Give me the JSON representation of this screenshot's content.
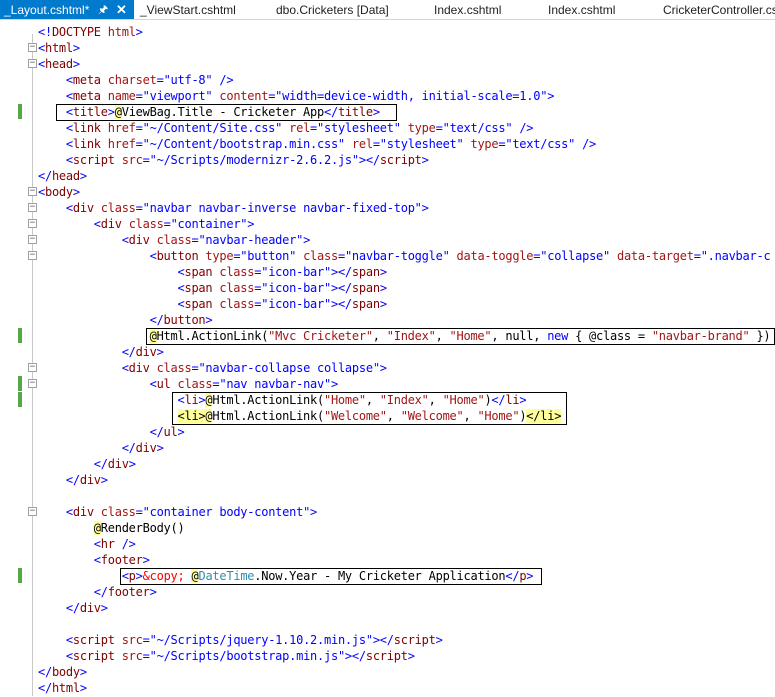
{
  "tabs": [
    {
      "label": "_Layout.cshtml*",
      "active": true
    },
    {
      "label": "_ViewStart.cshtml"
    },
    {
      "label": "dbo.Cricketers [Data]"
    },
    {
      "label": "Index.cshtml"
    },
    {
      "label": "Index.cshtml"
    },
    {
      "label": "CricketerController.cs"
    }
  ],
  "tab_icons": {
    "pin": "pin-icon",
    "close": "close-icon"
  },
  "colors": {
    "accent": "#007acc",
    "tag": "#800000",
    "attribute": "#ff0000",
    "value": "#0000ff",
    "razor_highlight": "#ffff99",
    "change_marker": "#57a64a"
  },
  "code": {
    "lines": [
      [
        [
          "<!",
          "pu"
        ],
        [
          "DOCTYPE",
          "kw"
        ],
        [
          " ",
          ""
        ],
        [
          "html",
          "at"
        ],
        [
          ">",
          "pu"
        ]
      ],
      [
        [
          "<",
          "pu"
        ],
        [
          "html",
          "kw"
        ],
        [
          ">",
          "pu"
        ]
      ],
      [
        [
          "<",
          "pu"
        ],
        [
          "head",
          "kw"
        ],
        [
          ">",
          "pu"
        ]
      ],
      [
        [
          "    <",
          "pu"
        ],
        [
          "meta",
          "kw"
        ],
        [
          " charset",
          "at"
        ],
        [
          "=",
          "pu"
        ],
        [
          "\"utf-8\"",
          "val"
        ],
        [
          " />",
          "pu"
        ]
      ],
      [
        [
          "    <",
          "pu"
        ],
        [
          "meta",
          "kw"
        ],
        [
          " name",
          "at"
        ],
        [
          "=",
          "pu"
        ],
        [
          "\"viewport\"",
          "val"
        ],
        [
          " content",
          "at"
        ],
        [
          "=",
          "pu"
        ],
        [
          "\"width=device-width, initial-scale=1.0\"",
          "val"
        ],
        [
          ">",
          "pu"
        ]
      ],
      [
        [
          "    <",
          "pu"
        ],
        [
          "title",
          "kw"
        ],
        [
          ">",
          "pu"
        ],
        [
          "@",
          "rz"
        ],
        [
          "ViewBag.Title - Cricketer App",
          "cs"
        ],
        [
          "</",
          "pu"
        ],
        [
          "title",
          "kw"
        ],
        [
          ">",
          "pu"
        ]
      ],
      [
        [
          "    <",
          "pu"
        ],
        [
          "link",
          "kw"
        ],
        [
          " href",
          "at"
        ],
        [
          "=",
          "pu"
        ],
        [
          "\"~/Content/Site.css\"",
          "val"
        ],
        [
          " rel",
          "at"
        ],
        [
          "=",
          "pu"
        ],
        [
          "\"stylesheet\"",
          "val"
        ],
        [
          " type",
          "at"
        ],
        [
          "=",
          "pu"
        ],
        [
          "\"text/css\"",
          "val"
        ],
        [
          " />",
          "pu"
        ]
      ],
      [
        [
          "    <",
          "pu"
        ],
        [
          "link",
          "kw"
        ],
        [
          " href",
          "at"
        ],
        [
          "=",
          "pu"
        ],
        [
          "\"~/Content/bootstrap.min.css\"",
          "val"
        ],
        [
          " rel",
          "at"
        ],
        [
          "=",
          "pu"
        ],
        [
          "\"stylesheet\"",
          "val"
        ],
        [
          " type",
          "at"
        ],
        [
          "=",
          "pu"
        ],
        [
          "\"text/css\"",
          "val"
        ],
        [
          " />",
          "pu"
        ]
      ],
      [
        [
          "    <",
          "pu"
        ],
        [
          "script",
          "kw"
        ],
        [
          " src",
          "at"
        ],
        [
          "=",
          "pu"
        ],
        [
          "\"~/Scripts/modernizr-2.6.2.js\"",
          "val"
        ],
        [
          "></",
          "pu"
        ],
        [
          "script",
          "kw"
        ],
        [
          ">",
          "pu"
        ]
      ],
      [
        [
          "</",
          "pu"
        ],
        [
          "head",
          "kw"
        ],
        [
          ">",
          "pu"
        ]
      ],
      [
        [
          "<",
          "pu"
        ],
        [
          "body",
          "kw"
        ],
        [
          ">",
          "pu"
        ]
      ],
      [
        [
          "    <",
          "pu"
        ],
        [
          "div",
          "kw"
        ],
        [
          " class",
          "at"
        ],
        [
          "=",
          "pu"
        ],
        [
          "\"navbar navbar-inverse navbar-fixed-top\"",
          "val"
        ],
        [
          ">",
          "pu"
        ]
      ],
      [
        [
          "        <",
          "pu"
        ],
        [
          "div",
          "kw"
        ],
        [
          " class",
          "at"
        ],
        [
          "=",
          "pu"
        ],
        [
          "\"container\"",
          "val"
        ],
        [
          ">",
          "pu"
        ]
      ],
      [
        [
          "            <",
          "pu"
        ],
        [
          "div",
          "kw"
        ],
        [
          " class",
          "at"
        ],
        [
          "=",
          "pu"
        ],
        [
          "\"navbar-header\"",
          "val"
        ],
        [
          ">",
          "pu"
        ]
      ],
      [
        [
          "                <",
          "pu"
        ],
        [
          "button",
          "kw"
        ],
        [
          " type",
          "at"
        ],
        [
          "=",
          "pu"
        ],
        [
          "\"button\"",
          "val"
        ],
        [
          " class",
          "at"
        ],
        [
          "=",
          "pu"
        ],
        [
          "\"navbar-toggle\"",
          "val"
        ],
        [
          " data-toggle",
          "at"
        ],
        [
          "=",
          "pu"
        ],
        [
          "\"collapse\"",
          "val"
        ],
        [
          " data-target",
          "at"
        ],
        [
          "=",
          "pu"
        ],
        [
          "\".navbar-c",
          "val"
        ]
      ],
      [
        [
          "                    <",
          "pu"
        ],
        [
          "span",
          "kw"
        ],
        [
          " class",
          "at"
        ],
        [
          "=",
          "pu"
        ],
        [
          "\"icon-bar\"",
          "val"
        ],
        [
          "></",
          "pu"
        ],
        [
          "span",
          "kw"
        ],
        [
          ">",
          "pu"
        ]
      ],
      [
        [
          "                    <",
          "pu"
        ],
        [
          "span",
          "kw"
        ],
        [
          " class",
          "at"
        ],
        [
          "=",
          "pu"
        ],
        [
          "\"icon-bar\"",
          "val"
        ],
        [
          "></",
          "pu"
        ],
        [
          "span",
          "kw"
        ],
        [
          ">",
          "pu"
        ]
      ],
      [
        [
          "                    <",
          "pu"
        ],
        [
          "span",
          "kw"
        ],
        [
          " class",
          "at"
        ],
        [
          "=",
          "pu"
        ],
        [
          "\"icon-bar\"",
          "val"
        ],
        [
          "></",
          "pu"
        ],
        [
          "span",
          "kw"
        ],
        [
          ">",
          "pu"
        ]
      ],
      [
        [
          "                </",
          "pu"
        ],
        [
          "button",
          "kw"
        ],
        [
          ">",
          "pu"
        ]
      ],
      [
        [
          "                ",
          ""
        ],
        [
          "@",
          "rz"
        ],
        [
          "Html.ActionLink(",
          "cs"
        ],
        [
          "\"Mvc Cricketer\"",
          "str"
        ],
        [
          ", ",
          "cs"
        ],
        [
          "\"Index\"",
          "str"
        ],
        [
          ", ",
          "cs"
        ],
        [
          "\"Home\"",
          "str"
        ],
        [
          ", null, ",
          "cs"
        ],
        [
          "new",
          "pu"
        ],
        [
          " { @class = ",
          "cs"
        ],
        [
          "\"navbar-brand\"",
          "str"
        ],
        [
          " })",
          "cs"
        ]
      ],
      [
        [
          "            </",
          "pu"
        ],
        [
          "div",
          "kw"
        ],
        [
          ">",
          "pu"
        ]
      ],
      [
        [
          "            <",
          "pu"
        ],
        [
          "div",
          "kw"
        ],
        [
          " class",
          "at"
        ],
        [
          "=",
          "pu"
        ],
        [
          "\"navbar-collapse collapse\"",
          "val"
        ],
        [
          ">",
          "pu"
        ]
      ],
      [
        [
          "                <",
          "pu"
        ],
        [
          "ul",
          "kw"
        ],
        [
          " class",
          "at"
        ],
        [
          "=",
          "pu"
        ],
        [
          "\"nav navbar-nav\"",
          "val"
        ],
        [
          ">",
          "pu"
        ]
      ],
      [
        [
          "                    <",
          "pu"
        ],
        [
          "li",
          "kw"
        ],
        [
          ">",
          "pu"
        ],
        [
          "@",
          "rz"
        ],
        [
          "Html.ActionLink(",
          "cs"
        ],
        [
          "\"Home\"",
          "str"
        ],
        [
          ", ",
          "cs"
        ],
        [
          "\"Index\"",
          "str"
        ],
        [
          ", ",
          "cs"
        ],
        [
          "\"Home\"",
          "str"
        ],
        [
          ")",
          "cs"
        ],
        [
          "</",
          "pu"
        ],
        [
          "li",
          "kw"
        ],
        [
          ">",
          "pu"
        ]
      ],
      [
        [
          "                    ",
          ""
        ],
        [
          "<li>",
          "rz"
        ],
        [
          "@",
          "rz"
        ],
        [
          "Html.ActionLink(",
          "cs"
        ],
        [
          "\"Welcome\"",
          "str"
        ],
        [
          ", ",
          "cs"
        ],
        [
          "\"Welcome\"",
          "str"
        ],
        [
          ", ",
          "cs"
        ],
        [
          "\"Home\"",
          "str"
        ],
        [
          ")",
          "cs"
        ],
        [
          "</li>",
          "rz"
        ]
      ],
      [
        [
          "                </",
          "pu"
        ],
        [
          "ul",
          "kw"
        ],
        [
          ">",
          "pu"
        ]
      ],
      [
        [
          "            </",
          "pu"
        ],
        [
          "div",
          "kw"
        ],
        [
          ">",
          "pu"
        ]
      ],
      [
        [
          "        </",
          "pu"
        ],
        [
          "div",
          "kw"
        ],
        [
          ">",
          "pu"
        ]
      ],
      [
        [
          "    </",
          "pu"
        ],
        [
          "div",
          "kw"
        ],
        [
          ">",
          "pu"
        ]
      ],
      [],
      [
        [
          "    <",
          "pu"
        ],
        [
          "div",
          "kw"
        ],
        [
          " class",
          "at"
        ],
        [
          "=",
          "pu"
        ],
        [
          "\"container body-content\"",
          "val"
        ],
        [
          ">",
          "pu"
        ]
      ],
      [
        [
          "        ",
          ""
        ],
        [
          "@",
          "rz"
        ],
        [
          "RenderBody()",
          "cs"
        ]
      ],
      [
        [
          "        <",
          "pu"
        ],
        [
          "hr",
          "kw"
        ],
        [
          " />",
          "pu"
        ]
      ],
      [
        [
          "        <",
          "pu"
        ],
        [
          "footer",
          "kw"
        ],
        [
          ">",
          "pu"
        ]
      ],
      [
        [
          "            <",
          "pu"
        ],
        [
          "p",
          "kw"
        ],
        [
          ">",
          "pu"
        ],
        [
          "&copy;",
          "ent"
        ],
        [
          " ",
          ""
        ],
        [
          "@",
          "rz"
        ],
        [
          "DateTime",
          "cls"
        ],
        [
          ".Now.Year - My Cricketer Application",
          "cs"
        ],
        [
          "</",
          "pu"
        ],
        [
          "p",
          "kw"
        ],
        [
          ">",
          "pu"
        ]
      ],
      [
        [
          "        </",
          "pu"
        ],
        [
          "footer",
          "kw"
        ],
        [
          ">",
          "pu"
        ]
      ],
      [
        [
          "    </",
          "pu"
        ],
        [
          "div",
          "kw"
        ],
        [
          ">",
          "pu"
        ]
      ],
      [],
      [
        [
          "    <",
          "pu"
        ],
        [
          "script",
          "kw"
        ],
        [
          " src",
          "at"
        ],
        [
          "=",
          "pu"
        ],
        [
          "\"~/Scripts/jquery-1.10.2.min.js\"",
          "val"
        ],
        [
          "></",
          "pu"
        ],
        [
          "script",
          "kw"
        ],
        [
          ">",
          "pu"
        ]
      ],
      [
        [
          "    <",
          "pu"
        ],
        [
          "script",
          "kw"
        ],
        [
          " src",
          "at"
        ],
        [
          "=",
          "pu"
        ],
        [
          "\"~/Scripts/bootstrap.min.js\"",
          "val"
        ],
        [
          "></",
          "pu"
        ],
        [
          "script",
          "kw"
        ],
        [
          ">",
          "pu"
        ]
      ],
      [
        [
          "</",
          "pu"
        ],
        [
          "body",
          "kw"
        ],
        [
          ">",
          "pu"
        ]
      ],
      [
        [
          "</",
          "pu"
        ],
        [
          "html",
          "kw"
        ],
        [
          ">",
          "pu"
        ]
      ]
    ],
    "changed_lines": [
      5,
      19,
      22,
      23,
      34
    ],
    "fold_lines": [
      1,
      2,
      10,
      11,
      12,
      13,
      14,
      21,
      22,
      30
    ]
  }
}
